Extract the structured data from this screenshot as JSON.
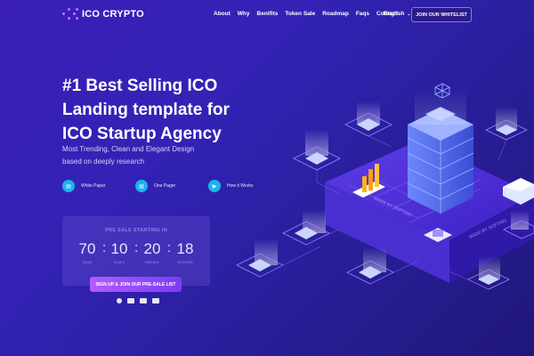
{
  "header": {
    "logo_text": "ICO CRYPTO",
    "nav": [
      "About",
      "Why",
      "Benifits",
      "Token Sale",
      "Roadmap",
      "Faqs",
      "Contact"
    ],
    "language": "English",
    "whitelist_button": "JOIN OUR WHITELIST"
  },
  "hero": {
    "title_lines": [
      "#1 Best Selling ICO",
      "Landing template for",
      "ICO Startup Agency"
    ],
    "subtitle_lines": [
      "Most Trending, Clean and Elegant Design",
      "based on deeply research"
    ],
    "links": [
      {
        "label": "White Paper",
        "icon": "document-icon"
      },
      {
        "label": "One Pager",
        "icon": "page-icon"
      },
      {
        "label": "How it Works",
        "icon": "play-icon"
      }
    ]
  },
  "presale": {
    "title": "PRE SALE STARTING IN",
    "countdown": [
      {
        "value": "70",
        "unit": "Days"
      },
      {
        "value": "10",
        "unit": "Hours"
      },
      {
        "value": "20",
        "unit": "Minutes"
      },
      {
        "value": "18",
        "unit": "Seconds"
      }
    ],
    "signup_button": "SIGN UP & JOIN OUR PRE-SALE LIST",
    "payment_icons": [
      "bitcoin-icon",
      "ethereum-icon",
      "visa-icon",
      "card-icon"
    ]
  },
  "illustration": {
    "platform_text_left": "MADE BY SOFTNIO",
    "platform_text_right": "MADE BY SOFTNIO"
  },
  "colors": {
    "accent": "#a06cff",
    "link_icon": "#19b4ef",
    "button_gradient_start": "#b25cff"
  }
}
